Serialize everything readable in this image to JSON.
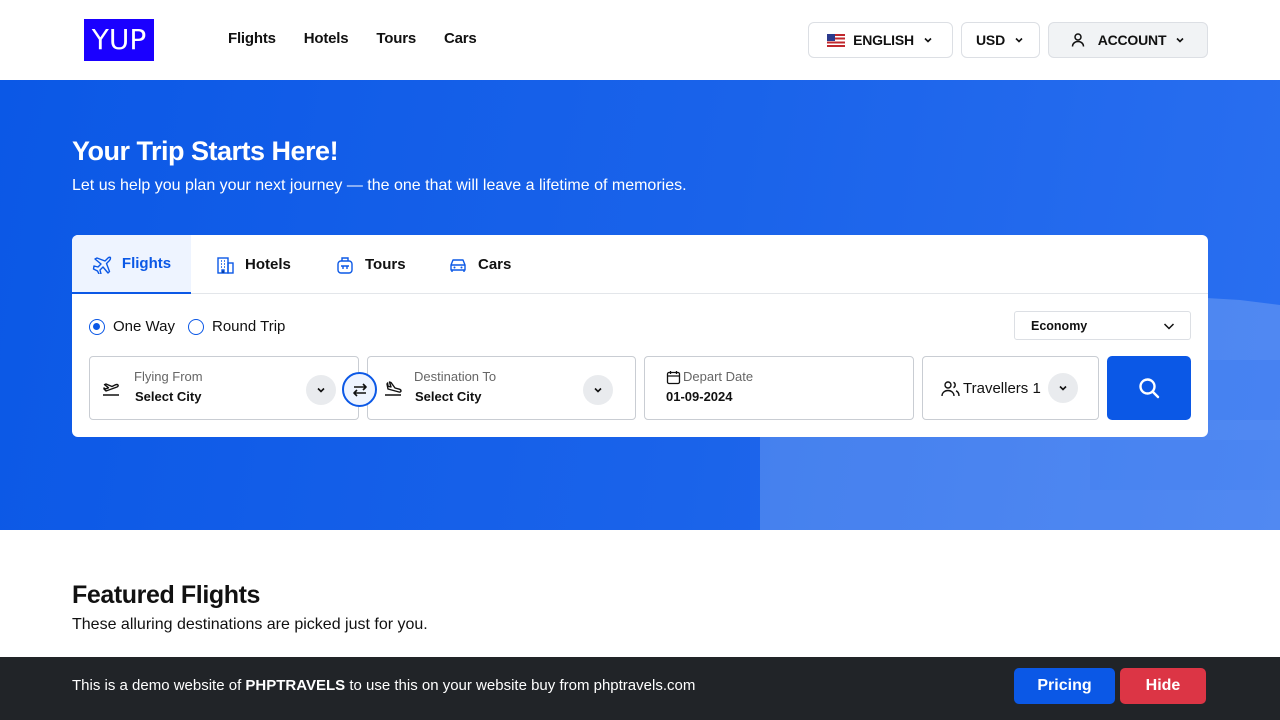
{
  "header": {
    "logo": "YUP",
    "nav": [
      "Flights",
      "Hotels",
      "Tours",
      "Cars"
    ],
    "language": "ENGLISH",
    "currency": "USD",
    "account": "ACCOUNT"
  },
  "hero": {
    "title": "Your Trip Starts Here!",
    "subtitle": "Let us help you plan your next journey — the one that will leave a lifetime of memories."
  },
  "search": {
    "tabs": [
      {
        "label": "Flights",
        "icon": "plane-icon",
        "active": true
      },
      {
        "label": "Hotels",
        "icon": "building-icon",
        "active": false
      },
      {
        "label": "Tours",
        "icon": "luggage-icon",
        "active": false
      },
      {
        "label": "Cars",
        "icon": "car-icon",
        "active": false
      }
    ],
    "trip_types": [
      {
        "label": "One Way",
        "checked": true
      },
      {
        "label": "Round Trip",
        "checked": false
      }
    ],
    "cabin_class": "Economy",
    "from": {
      "label": "Flying From",
      "value": "Select City"
    },
    "to": {
      "label": "Destination To",
      "value": "Select City"
    },
    "depart": {
      "label": "Depart Date",
      "value": "01-09-2024"
    },
    "travellers": {
      "label": "Travellers",
      "count": "1"
    }
  },
  "featured": {
    "title": "Featured Flights",
    "subtitle": "These alluring destinations are picked just for you."
  },
  "demo_bar": {
    "prefix": "This is a demo website of ",
    "brand": "PHPTRAVELS",
    "suffix": " to use this on your website buy from phptravels.com",
    "pricing": "Pricing",
    "hide": "Hide"
  },
  "colors": {
    "primary": "#0b58e6",
    "danger": "#dc3545",
    "logo_bg": "#1a00ff",
    "bar_bg": "#212428"
  }
}
